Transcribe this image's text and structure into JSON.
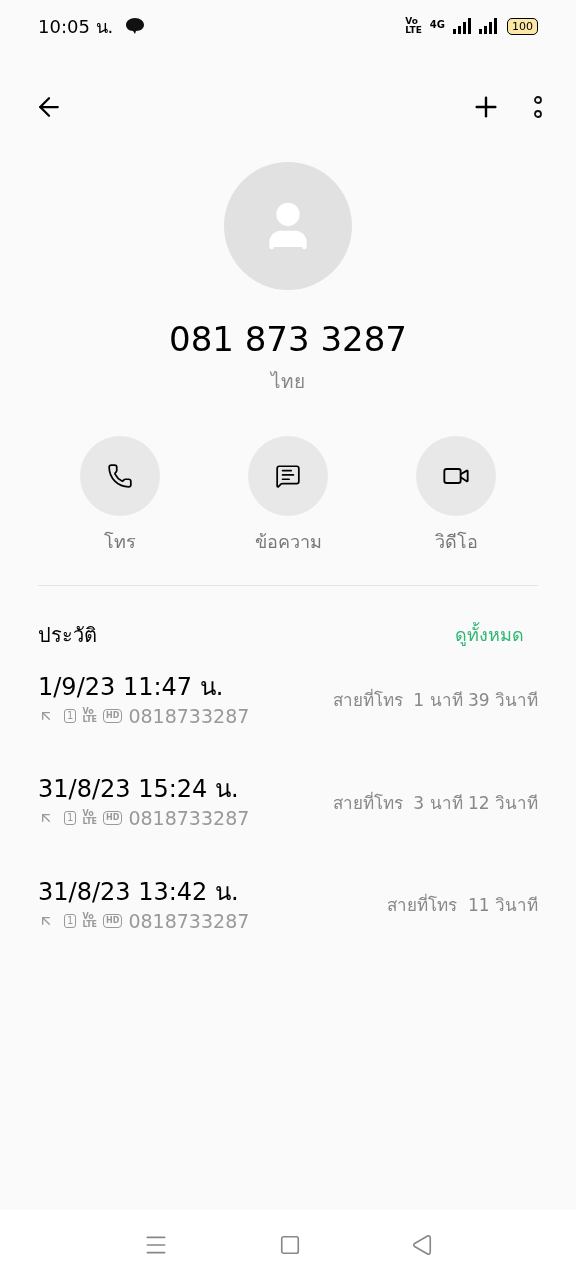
{
  "status_bar": {
    "time": "10:05 น.",
    "volte": [
      "Vo",
      "LTE"
    ],
    "network": "4G",
    "battery": "100"
  },
  "contact": {
    "number": "081 873 3287",
    "location": "ไทย"
  },
  "actions": [
    {
      "kind": "call",
      "label": "โทร"
    },
    {
      "kind": "message",
      "label": "ข้อความ"
    },
    {
      "kind": "video",
      "label": "วิดีโอ"
    }
  ],
  "history": {
    "title": "ประวัติ",
    "see_all": "ดูทั้งหมด",
    "entries": [
      {
        "datetime": "1/9/23 11:47 น.",
        "sim": "1",
        "volte": [
          "Vo",
          "LTE"
        ],
        "hd": "HD",
        "number": "0818733287",
        "type": "สายที่โทร",
        "duration": "1 นาที 39 วินาที"
      },
      {
        "datetime": "31/8/23 15:24 น.",
        "sim": "1",
        "volte": [
          "Vo",
          "LTE"
        ],
        "hd": "HD",
        "number": "0818733287",
        "type": "สายที่โทร",
        "duration": "3 นาที 12 วินาที"
      },
      {
        "datetime": "31/8/23 13:42 น.",
        "sim": "1",
        "volte": [
          "Vo",
          "LTE"
        ],
        "hd": "HD",
        "number": "0818733287",
        "type": "สายที่โทร",
        "duration": "11 วินาที"
      }
    ]
  }
}
